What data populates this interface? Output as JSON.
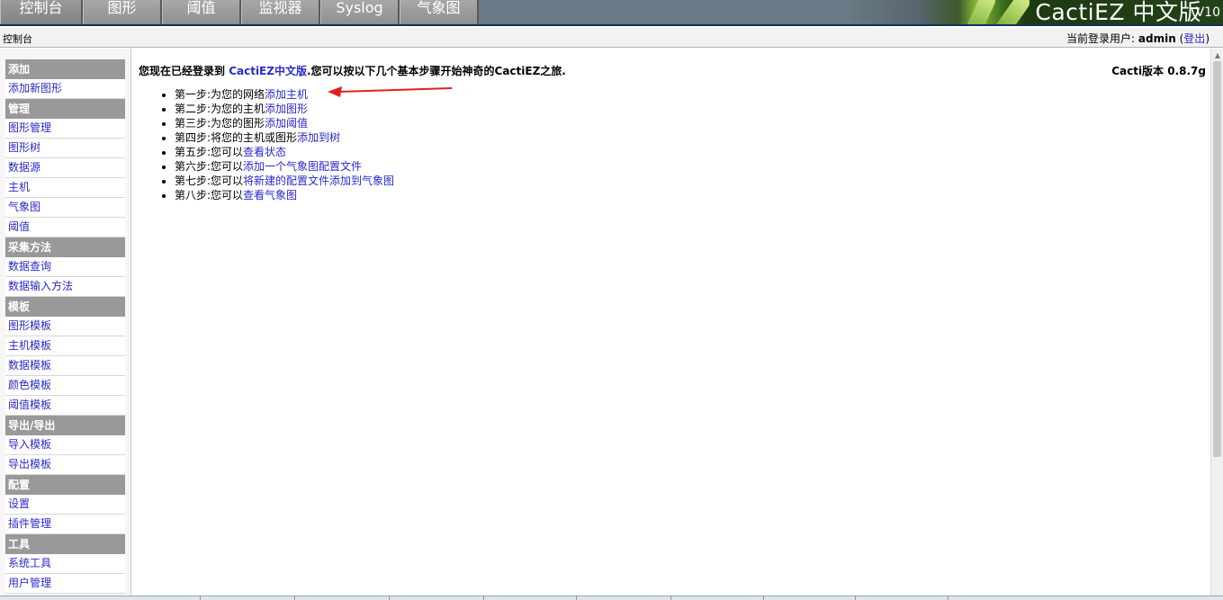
{
  "tabs": [
    {
      "label": "控制台",
      "width": 92
    },
    {
      "label": "图形",
      "width": 88
    },
    {
      "label": "阈值",
      "width": 88
    },
    {
      "label": "监视器",
      "width": 88
    },
    {
      "label": "Syslog",
      "width": 88
    },
    {
      "label": "气象图",
      "width": 88
    }
  ],
  "banner": {
    "brand": "CactiEZ 中文版",
    "version": "V10"
  },
  "breadcrumb": "控制台",
  "user": {
    "prefix": "当前登录用户:",
    "name": "admin",
    "open_paren": "(",
    "logout": "登出",
    "close_paren": ")"
  },
  "sidebar": [
    {
      "section": "添加",
      "items": [
        "添加新图形"
      ]
    },
    {
      "section": "管理",
      "items": [
        "图形管理",
        "图形树",
        "数据源",
        "主机",
        "气象图",
        "阈值"
      ]
    },
    {
      "section": "采集方法",
      "items": [
        "数据查询",
        "数据输入方法"
      ]
    },
    {
      "section": "模板",
      "items": [
        "图形模板",
        "主机模板",
        "数据模板",
        "颜色模板",
        "阈值模板"
      ]
    },
    {
      "section": "导出/导出",
      "items": [
        "导入模板",
        "导出模板"
      ]
    },
    {
      "section": "配置",
      "items": [
        "设置",
        "插件管理"
      ]
    },
    {
      "section": "工具",
      "items": [
        "系统工具",
        "用户管理"
      ]
    }
  ],
  "welcome": {
    "pre": "您现在已经登录到 ",
    "product": "CactiEZ中文版",
    "post": ".您可以按以下几个基本步骤开始神奇的CactiEZ之旅."
  },
  "version_text": "Cacti版本 0.8.7g",
  "steps": [
    {
      "text": "第一步:为您的网络",
      "link": "添加主机"
    },
    {
      "text": "第二步:为您的主机",
      "link": "添加图形"
    },
    {
      "text": "第三步:为您的图形",
      "link": "添加阈值"
    },
    {
      "text": "第四步:将您的主机或图形",
      "link": "添加到树"
    },
    {
      "text": "第五步:您可以",
      "link": "查看状态"
    },
    {
      "text": "第六步:您可以",
      "link": "添加一个气象图配置文件"
    },
    {
      "text": "第七步:您可以",
      "link": "将新建的配置文件添加到气象图"
    },
    {
      "text": "第八步:您可以",
      "link": "查看气象图"
    }
  ],
  "colors": {
    "link": "#2a2ac8",
    "section": "#999999",
    "arrow": "#e02020",
    "nav_border": "#13305c"
  }
}
